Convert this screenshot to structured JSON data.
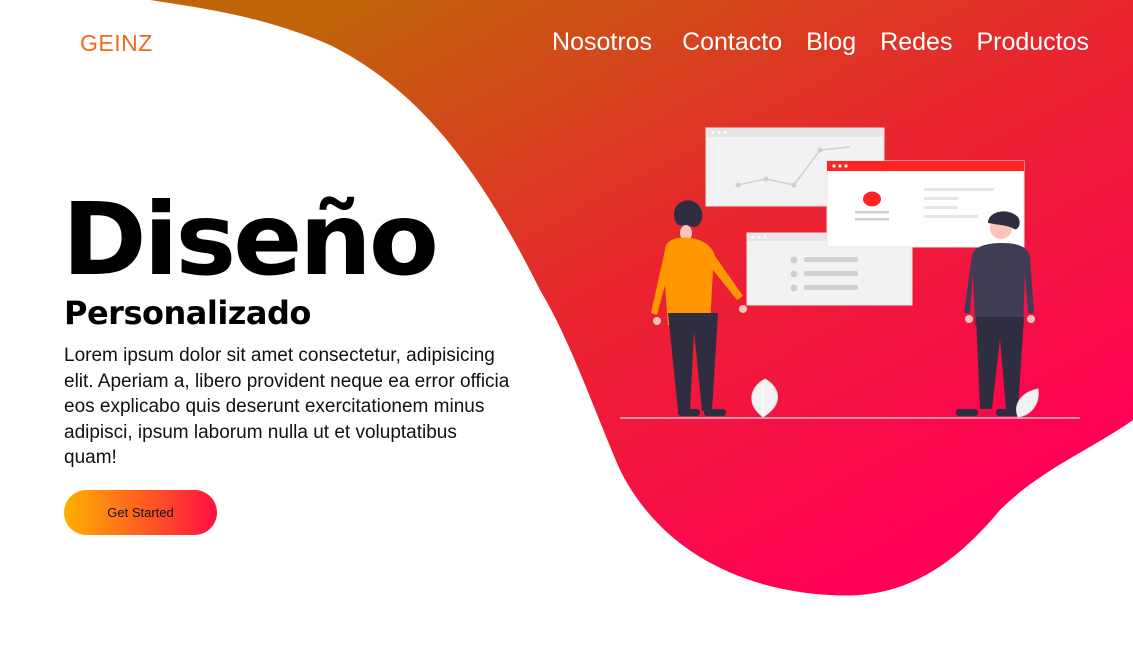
{
  "brand": {
    "logo_text": "GEINZ"
  },
  "nav": {
    "items": [
      "Nosotros",
      "Contacto",
      "Blog",
      "Redes",
      "Productos"
    ]
  },
  "hero": {
    "title": "Diseño",
    "subtitle": "Personalizado",
    "body": "Lorem ipsum dolor sit amet consectetur, adipisicing elit. Aperiam a, libero provident neque ea error officia eos explicabo quis deserunt exercitationem minus adipisci, ipsum laborum nulla ut et  voluptatibus quam!",
    "cta_label": "Get Started"
  },
  "colors": {
    "logo": "#f26a1b",
    "gradient_start": "#c0650a",
    "gradient_mid": "#e8262e",
    "gradient_end": "#ff0055",
    "cta_start": "#ffb000",
    "cta_end": "#ff1040",
    "woman_shirt": "#ff9800",
    "dark_figure": "#2f2e41",
    "accent_red": "#ff2323"
  },
  "illustration": {
    "icons": [
      "line-chart-window",
      "profile-card-window",
      "list-window",
      "woman-figure",
      "man-figure",
      "leaf-plant"
    ]
  }
}
